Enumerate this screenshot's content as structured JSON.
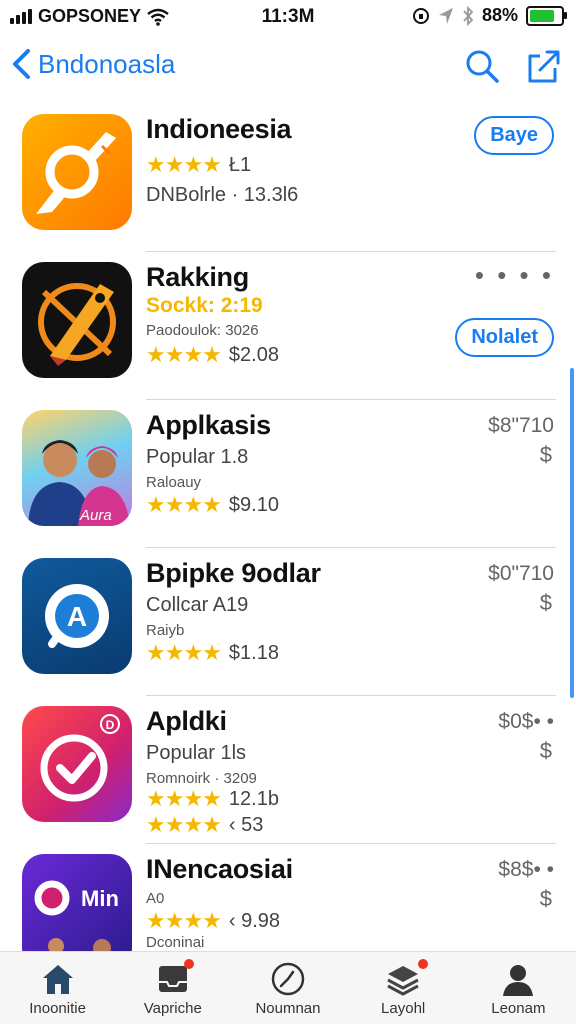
{
  "status_bar": {
    "carrier": "GOPSONEY",
    "time": "11:3M",
    "battery": "88%"
  },
  "nav": {
    "back_label": "Bndonoasla"
  },
  "apps": [
    {
      "title": "Indioneesia",
      "line1": "Ł1",
      "line2": "DNBolrle · 13.3l6",
      "button": "Baye"
    },
    {
      "title": "Rakking",
      "line1": "Sockk: 2:19",
      "line2": "Paodoulok: 3026",
      "rating_text": "$2.08",
      "more": "• • • •",
      "button": "Nolalet"
    },
    {
      "title": "Applkasis",
      "line1": "Popular 1.8",
      "line2": "Raloauy",
      "rating_text": "$9.10",
      "price": "$8\"710",
      "dollar": "$"
    },
    {
      "title": "Bpipke 9odlar",
      "line1": "Collcar A19",
      "line2": "Raiyb",
      "rating_text": "$1.18",
      "price": "$0\"710",
      "dollar": "$",
      "icon_letter": "A"
    },
    {
      "title": "Apldki",
      "line1": "Popular 1ls",
      "line2": "Romnoirk · 3209",
      "rating_text": "12.1b",
      "rating_text2": "‹ 53",
      "price": "$0$• •",
      "dollar": "$",
      "badge": "D"
    },
    {
      "title": "INencaosiai",
      "line1": "A0",
      "line2": "Dconinai",
      "rating_text": "‹ 9.98",
      "price": "$8$• •",
      "dollar": "$",
      "icon_text": "Min"
    }
  ],
  "tabs": [
    {
      "label": "Inoonitie"
    },
    {
      "label": "Vapriche"
    },
    {
      "label": "Noumnan"
    },
    {
      "label": "Layohl"
    },
    {
      "label": "Leonam"
    }
  ],
  "colors": {
    "accent": "#1a7cf0",
    "star": "#f5b800",
    "badge": "#e33322"
  },
  "stars": "★★★★"
}
